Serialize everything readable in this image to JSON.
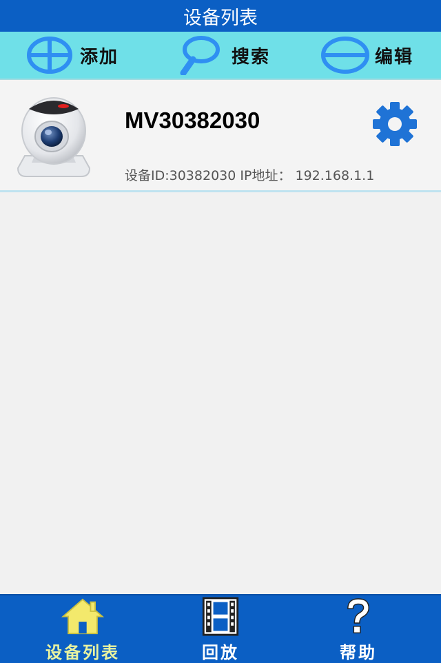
{
  "header": {
    "title": "设备列表"
  },
  "toolbar": {
    "add_label": "添加",
    "search_label": "搜索",
    "edit_label": "编辑"
  },
  "devices": [
    {
      "name": "MV30382030",
      "info": "设备ID:30382030 IP地址： 192.168.1.1",
      "icon": "webcam-icon",
      "settings_icon": "gear-icon"
    }
  ],
  "tabbar": {
    "tabs": [
      {
        "label": "设备列表",
        "icon": "home-icon",
        "active": true
      },
      {
        "label": "回放",
        "icon": "film-icon",
        "active": false
      },
      {
        "label": "帮助",
        "icon": "question-icon",
        "active": false
      }
    ]
  },
  "colors": {
    "header_bg": "#0b5fc4",
    "toolbar_bg": "#6fe0e8",
    "icon_blue": "#2f8ff2",
    "gear_blue": "#1f73d6",
    "active_tab_label": "#e9f3a0"
  }
}
